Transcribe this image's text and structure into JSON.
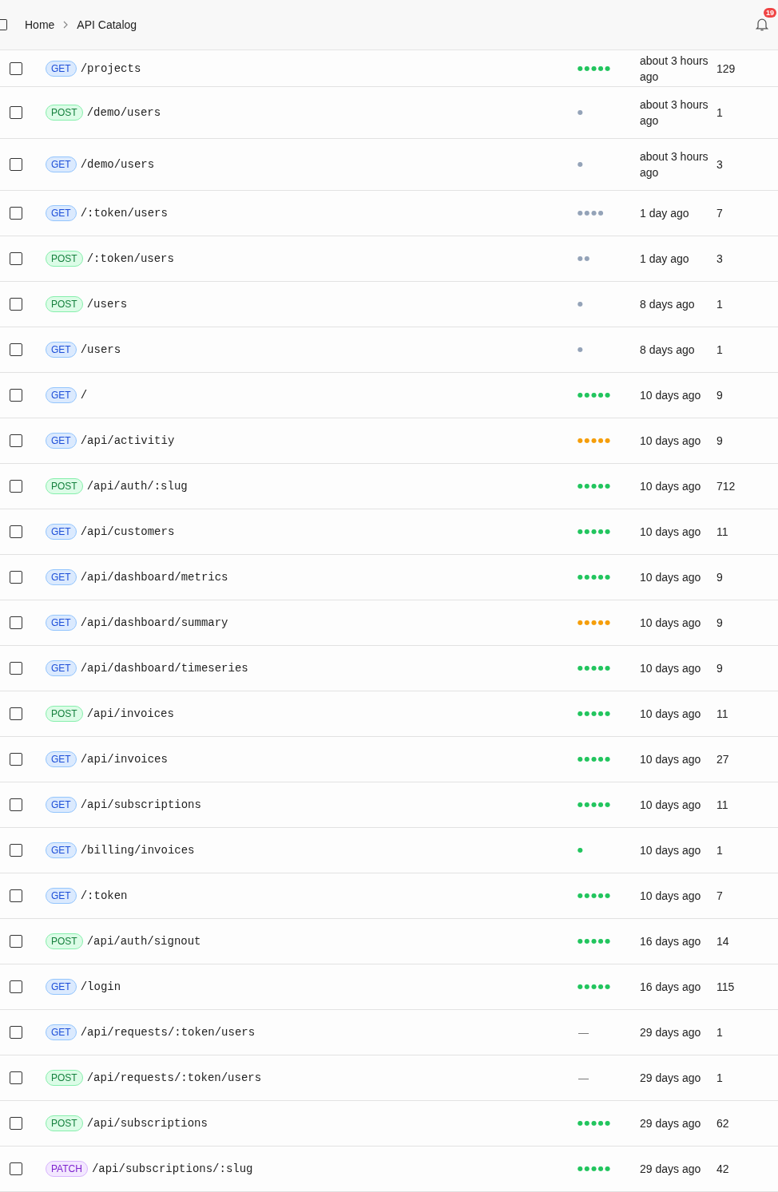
{
  "header": {
    "breadcrumbs": [
      {
        "label": "Home"
      },
      {
        "label": "API Catalog"
      }
    ],
    "notifications": {
      "count": "19"
    }
  },
  "rows": [
    {
      "method": "GET",
      "path": "/projects",
      "activity": {
        "kind": "dots",
        "text": "●●●●●",
        "color": "#22c55e"
      },
      "last_seen": "about 3 hours ago",
      "count": "129",
      "checked": false
    },
    {
      "method": "POST",
      "path": "/demo/users",
      "activity": {
        "kind": "dots",
        "text": "●",
        "color": "#94a3b8"
      },
      "last_seen": "about 3 hours ago",
      "count": "1",
      "checked": false
    },
    {
      "method": "GET",
      "path": "/demo/users",
      "activity": {
        "kind": "dots",
        "text": "●",
        "color": "#94a3b8"
      },
      "last_seen": "about 3 hours ago",
      "count": "3",
      "checked": false
    },
    {
      "method": "GET",
      "path": "/:token/users",
      "activity": {
        "kind": "dots",
        "text": "●●●●",
        "color": "#94a3b8"
      },
      "last_seen": "1 day ago",
      "count": "7",
      "checked": false
    },
    {
      "method": "POST",
      "path": "/:token/users",
      "activity": {
        "kind": "dots",
        "text": "●●",
        "color": "#94a3b8"
      },
      "last_seen": "1 day ago",
      "count": "3",
      "checked": false
    },
    {
      "method": "POST",
      "path": "/users",
      "activity": {
        "kind": "dots",
        "text": "●",
        "color": "#94a3b8"
      },
      "last_seen": "8 days ago",
      "count": "1",
      "checked": false
    },
    {
      "method": "GET",
      "path": "/users",
      "activity": {
        "kind": "dots",
        "text": "●",
        "color": "#94a3b8"
      },
      "last_seen": "8 days ago",
      "count": "1",
      "checked": false
    },
    {
      "method": "GET",
      "path": "/",
      "activity": {
        "kind": "dots",
        "text": "●●●●●",
        "color": "#22c55e"
      },
      "last_seen": "10 days ago",
      "count": "9",
      "checked": false
    },
    {
      "method": "GET",
      "path": "/api/activitiy",
      "activity": {
        "kind": "dots",
        "text": "●●●●●",
        "color": "#f59e0b"
      },
      "last_seen": "10 days ago",
      "count": "9",
      "checked": false
    },
    {
      "method": "POST",
      "path": "/api/auth/:slug",
      "activity": {
        "kind": "dots",
        "text": "●●●●●",
        "color": "#22c55e"
      },
      "last_seen": "10 days ago",
      "count": "712",
      "checked": false
    },
    {
      "method": "GET",
      "path": "/api/customers",
      "activity": {
        "kind": "dots",
        "text": "●●●●●",
        "color": "#22c55e"
      },
      "last_seen": "10 days ago",
      "count": "11",
      "checked": false
    },
    {
      "method": "GET",
      "path": "/api/dashboard/metrics",
      "activity": {
        "kind": "dots",
        "text": "●●●●●",
        "color": "#22c55e"
      },
      "last_seen": "10 days ago",
      "count": "9",
      "checked": false
    },
    {
      "method": "GET",
      "path": "/api/dashboard/summary",
      "activity": {
        "kind": "dots",
        "text": "●●●●●",
        "color": "#f59e0b"
      },
      "last_seen": "10 days ago",
      "count": "9",
      "checked": false
    },
    {
      "method": "GET",
      "path": "/api/dashboard/timeseries",
      "activity": {
        "kind": "dots",
        "text": "●●●●●",
        "color": "#22c55e"
      },
      "last_seen": "10 days ago",
      "count": "9",
      "checked": false
    },
    {
      "method": "POST",
      "path": "/api/invoices",
      "activity": {
        "kind": "dots",
        "text": "●●●●●",
        "color": "#22c55e"
      },
      "last_seen": "10 days ago",
      "count": "11",
      "checked": false
    },
    {
      "method": "GET",
      "path": "/api/invoices",
      "activity": {
        "kind": "dots",
        "text": "●●●●●",
        "color": "#22c55e"
      },
      "last_seen": "10 days ago",
      "count": "27",
      "checked": false
    },
    {
      "method": "GET",
      "path": "/api/subscriptions",
      "activity": {
        "kind": "dots",
        "text": "●●●●●",
        "color": "#22c55e"
      },
      "last_seen": "10 days ago",
      "count": "11",
      "checked": false
    },
    {
      "method": "GET",
      "path": "/billing/invoices",
      "activity": {
        "kind": "dots",
        "text": "●",
        "color": "#22c55e"
      },
      "last_seen": "10 days ago",
      "count": "1",
      "checked": false
    },
    {
      "method": "GET",
      "path": "/:token",
      "activity": {
        "kind": "dots",
        "text": "●●●●●",
        "color": "#22c55e"
      },
      "last_seen": "10 days ago",
      "count": "7",
      "checked": false
    },
    {
      "method": "POST",
      "path": "/api/auth/signout",
      "activity": {
        "kind": "dots",
        "text": "●●●●●",
        "color": "#22c55e"
      },
      "last_seen": "16 days ago",
      "count": "14",
      "checked": false
    },
    {
      "method": "GET",
      "path": "/login",
      "activity": {
        "kind": "dots",
        "text": "●●●●●",
        "color": "#22c55e"
      },
      "last_seen": "16 days ago",
      "count": "115",
      "checked": false
    },
    {
      "method": "GET",
      "path": "/api/requests/:token/users",
      "activity": {
        "kind": "none",
        "text": "—"
      },
      "last_seen": "29 days ago",
      "count": "1",
      "checked": false
    },
    {
      "method": "POST",
      "path": "/api/requests/:token/users",
      "activity": {
        "kind": "none",
        "text": "—"
      },
      "last_seen": "29 days ago",
      "count": "1",
      "checked": false
    },
    {
      "method": "POST",
      "path": "/api/subscriptions",
      "activity": {
        "kind": "dots",
        "text": "●●●●●",
        "color": "#22c55e"
      },
      "last_seen": "29 days ago",
      "count": "62",
      "checked": false
    },
    {
      "method": "PATCH",
      "path": "/api/subscriptions/:slug",
      "activity": {
        "kind": "dots",
        "text": "●●●●●",
        "color": "#22c55e"
      },
      "last_seen": "29 days ago",
      "count": "42",
      "checked": false
    }
  ]
}
